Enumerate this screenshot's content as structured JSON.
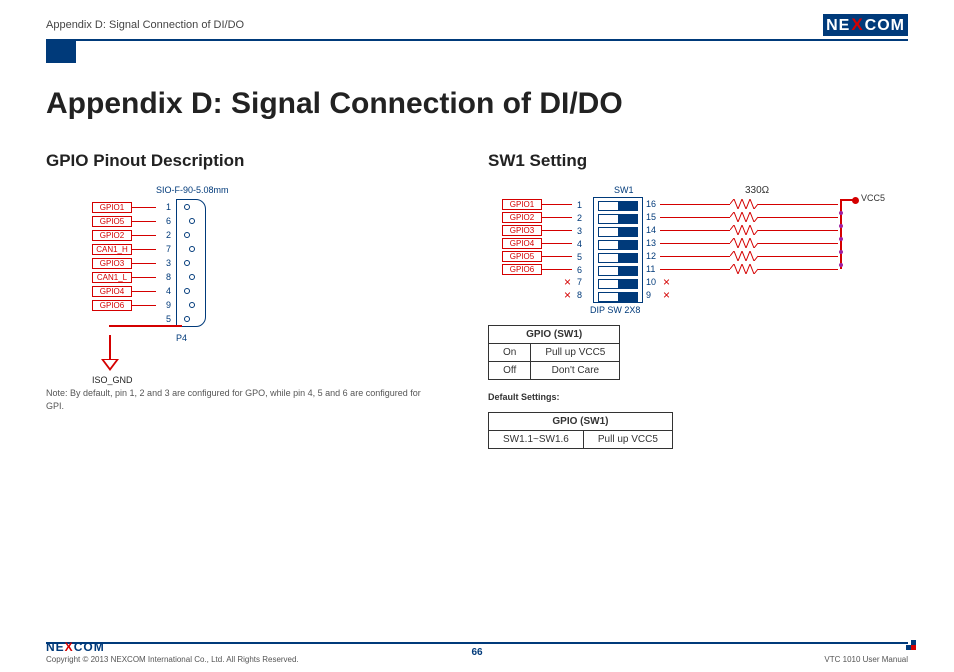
{
  "header": {
    "doc_section": "Appendix D: Signal Connection of DI/DO",
    "brand_left": "NE",
    "brand_x": "X",
    "brand_right": "COM"
  },
  "title": "Appendix D: Signal Connection of DI/DO",
  "left": {
    "heading": "GPIO Pinout Description",
    "connector_type": "SIO-F-90-5.08mm",
    "connector_ref": "P4",
    "pins": [
      {
        "label": "GPIO1",
        "num": "1"
      },
      {
        "label": "GPIO5",
        "num": "6"
      },
      {
        "label": "GPIO2",
        "num": "2"
      },
      {
        "label": "CAN1_H",
        "num": "7"
      },
      {
        "label": "GPIO3",
        "num": "3"
      },
      {
        "label": "CAN1_L",
        "num": "8"
      },
      {
        "label": "GPIO4",
        "num": "4"
      },
      {
        "label": "GPIO6",
        "num": "9"
      },
      {
        "label": "",
        "num": "5"
      }
    ],
    "gnd_label": "ISO_GND",
    "note": "Note: By default, pin 1, 2 and 3 are configured for GPO, while pin 4, 5 and 6 are configured for GPI."
  },
  "right": {
    "heading": "SW1 Setting",
    "sw_title": "SW1",
    "dip_label": "DIP SW 2X8",
    "left_rows": [
      {
        "label": "GPIO1",
        "num": "1"
      },
      {
        "label": "GPIO2",
        "num": "2"
      },
      {
        "label": "GPIO3",
        "num": "3"
      },
      {
        "label": "GPIO4",
        "num": "4"
      },
      {
        "label": "GPIO5",
        "num": "5"
      },
      {
        "label": "GPIO6",
        "num": "6"
      },
      {
        "label": "",
        "num": "7"
      },
      {
        "label": "",
        "num": "8"
      }
    ],
    "right_nums": [
      "16",
      "15",
      "14",
      "13",
      "12",
      "11",
      "10",
      "9"
    ],
    "resistor_label": "330Ω",
    "vcc_label": "VCC5",
    "table1": {
      "header": "GPIO (SW1)",
      "rows": [
        [
          "On",
          "Pull up VCC5"
        ],
        [
          "Off",
          "Don't Care"
        ]
      ]
    },
    "default_label": "Default Settings:",
    "table2": {
      "header": "GPIO (SW1)",
      "rows": [
        [
          "SW1.1~SW1.6",
          "Pull up VCC5"
        ]
      ]
    }
  },
  "footer": {
    "copyright": "Copyright © 2013 NEXCOM International Co., Ltd. All Rights Reserved.",
    "page": "66",
    "manual": "VTC 1010 User Manual"
  }
}
